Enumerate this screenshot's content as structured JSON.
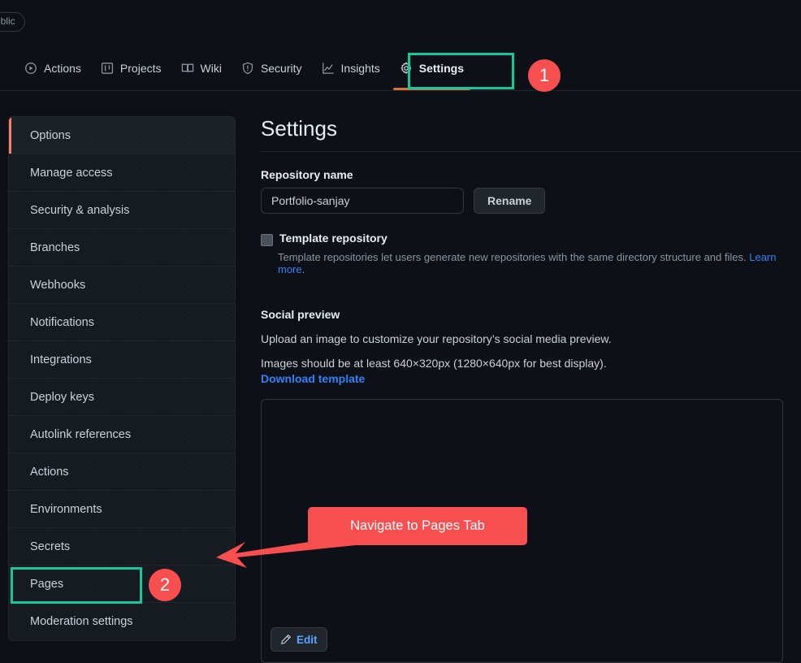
{
  "header": {
    "visibility_badge": "Public",
    "nav": [
      {
        "label": "Actions",
        "icon": "play-circle-icon",
        "active": false
      },
      {
        "label": "Projects",
        "icon": "project-board-icon",
        "active": false
      },
      {
        "label": "Wiki",
        "icon": "book-icon",
        "active": false
      },
      {
        "label": "Security",
        "icon": "shield-alert-icon",
        "active": false
      },
      {
        "label": "Insights",
        "icon": "graph-icon",
        "active": false
      },
      {
        "label": "Settings",
        "icon": "gear-icon",
        "active": true
      }
    ]
  },
  "sidebar": {
    "items": [
      {
        "label": "Options",
        "selected": true
      },
      {
        "label": "Manage access",
        "selected": false
      },
      {
        "label": "Security & analysis",
        "selected": false
      },
      {
        "label": "Branches",
        "selected": false
      },
      {
        "label": "Webhooks",
        "selected": false
      },
      {
        "label": "Notifications",
        "selected": false
      },
      {
        "label": "Integrations",
        "selected": false
      },
      {
        "label": "Deploy keys",
        "selected": false
      },
      {
        "label": "Autolink references",
        "selected": false
      },
      {
        "label": "Actions",
        "selected": false
      },
      {
        "label": "Environments",
        "selected": false
      },
      {
        "label": "Secrets",
        "selected": false
      },
      {
        "label": "Pages",
        "selected": false
      },
      {
        "label": "Moderation settings",
        "selected": false
      }
    ]
  },
  "main": {
    "title": "Settings",
    "repository_name_label": "Repository name",
    "repository_name_value": "Portfolio-sanjay",
    "repository_name_placeholder": "Repository name",
    "rename_button": "Rename",
    "template_repo_label": "Template repository",
    "template_repo_help": "Template repositories let users generate new repositories with the same directory structure and files.",
    "template_repo_help_link": "Learn more",
    "template_repo_help_end": ".",
    "social_preview_heading": "Social preview",
    "social_preview_line1": "Upload an image to customize your repository’s social media preview.",
    "social_preview_line2": "Images should be at least 640×320px (1280×640px for best display).",
    "download_template_link": "Download template",
    "edit_button": "Edit"
  },
  "annotations": {
    "badge_1": "1",
    "badge_2": "2",
    "callout_text": "Navigate to Pages Tab",
    "highlight_color": "#16c79a",
    "callout_color": "#f74f4f"
  }
}
